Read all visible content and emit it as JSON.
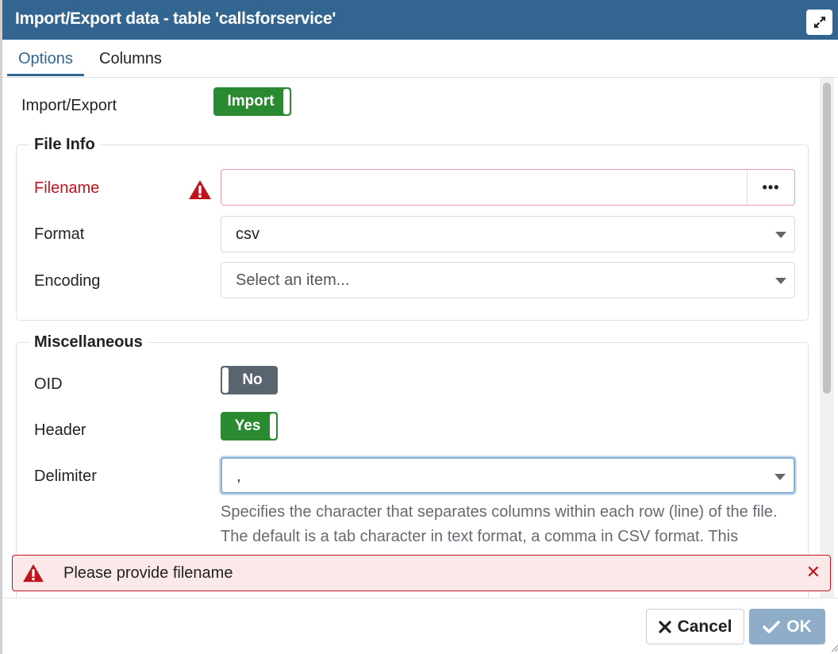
{
  "dialog": {
    "title": "Import/Export data - table 'callsforservice'"
  },
  "tabs": [
    {
      "label": "Options",
      "active": true
    },
    {
      "label": "Columns",
      "active": false
    }
  ],
  "import_export": {
    "label": "Import/Export",
    "toggle_value": "Import"
  },
  "file_info": {
    "legend": "File Info",
    "filename": {
      "label": "Filename",
      "value": "",
      "browse_label": "•••"
    },
    "format": {
      "label": "Format",
      "value": "csv"
    },
    "encoding": {
      "label": "Encoding",
      "placeholder": "Select an item..."
    }
  },
  "misc": {
    "legend": "Miscellaneous",
    "oid": {
      "label": "OID",
      "toggle_value": "No"
    },
    "header": {
      "label": "Header",
      "toggle_value": "Yes"
    },
    "delimiter": {
      "label": "Delimiter",
      "value": ",",
      "help": "Specifies the character that separates columns within each row (line) of the file. The default is a tab character in text format, a comma in CSV format. This"
    }
  },
  "error": {
    "message": "Please provide filename"
  },
  "footer": {
    "cancel_label": "Cancel",
    "ok_label": "OK"
  },
  "colors": {
    "titlebar": "#326690",
    "toggle_on": "#2a8a32",
    "toggle_off": "#5a6470",
    "error": "#c1121f",
    "ok_button": "#8fadc8"
  }
}
